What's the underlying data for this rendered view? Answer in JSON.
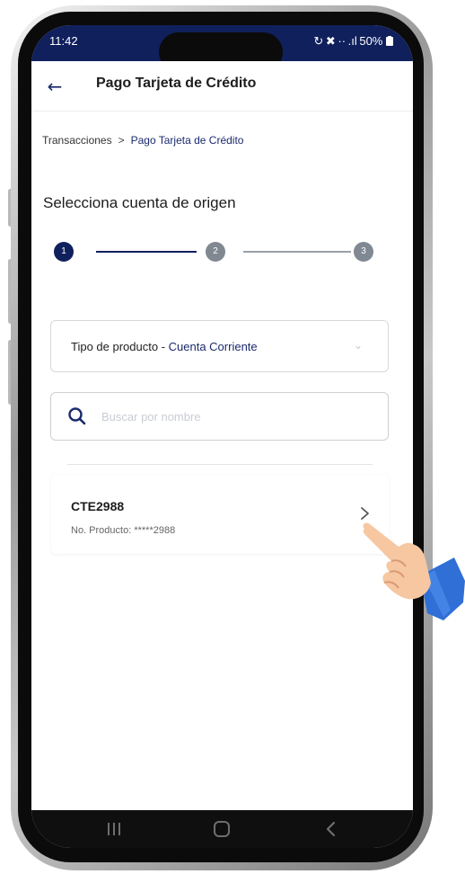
{
  "status_bar": {
    "time": "11:42",
    "right_icons_text": "↻ ✖ ·· .ıl 50%",
    "battery": "50%",
    "color": "#10205c"
  },
  "app_bar": {
    "back_icon": "arrow-left-icon",
    "title": "Pago Tarjeta de Crédito"
  },
  "breadcrumb": {
    "items": [
      "Transacciones",
      "Pago Tarjeta de Crédito"
    ],
    "separator": ">"
  },
  "section_title": "Selecciona cuenta de origen",
  "stepper": {
    "steps": [
      "1",
      "2",
      "3"
    ],
    "current": 1,
    "active_color": "#10205c",
    "idle_color": "#808892"
  },
  "product_type": {
    "label": "Tipo de producto - ",
    "value": "Cuenta Corriente",
    "chevron_icon": "chevron-down-icon"
  },
  "search": {
    "placeholder": "Buscar por nombre",
    "value": "",
    "icon": "search-icon"
  },
  "accounts": [
    {
      "name": "CTE2988",
      "product_label": "No. Producto: ",
      "product_number": "*****2988",
      "chevron_icon": "chevron-right-icon"
    }
  ],
  "nav_bar": {
    "buttons": [
      "recents-icon",
      "home-icon",
      "back-icon"
    ]
  },
  "overlay": {
    "pointer_icon": "hand-pointer-icon"
  }
}
